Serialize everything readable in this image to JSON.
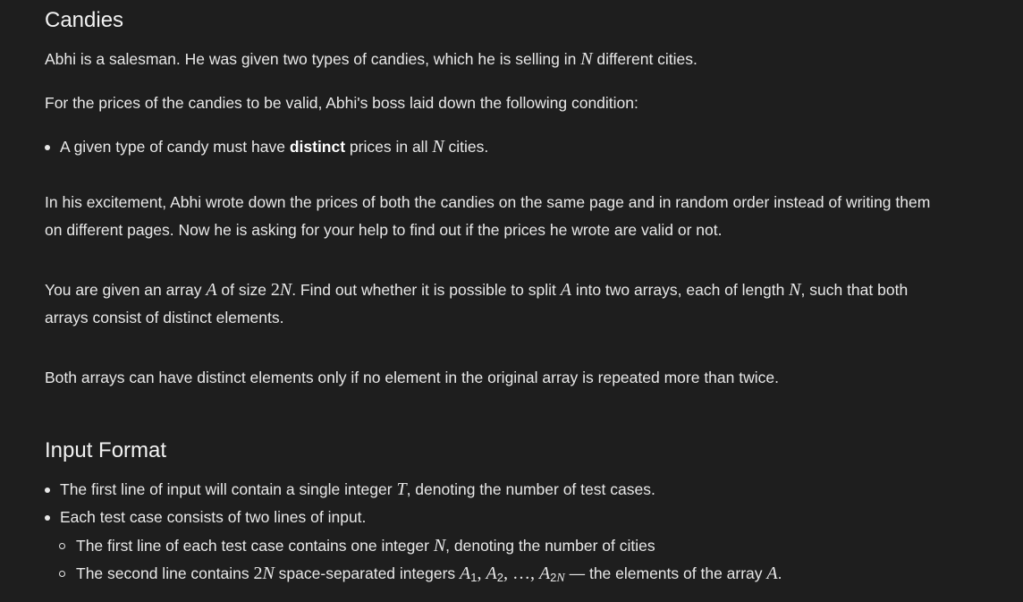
{
  "title": "Candies",
  "intro": {
    "p1_a": "Abhi is a salesman. He was given two types of candies, which he is selling in ",
    "p1_N": "N",
    "p1_b": " different cities.",
    "p2": "For the prices of the candies to be valid, Abhi's boss laid down the following condition:",
    "bullet_a": "A given type of candy must have ",
    "bullet_bold": "distinct",
    "bullet_b": " prices in all ",
    "bullet_N": "N",
    "bullet_c": " cities.",
    "p3_line1": "In his excitement, Abhi wrote down the prices of both the candies on the same page and in random order instead of writing them",
    "p3_line2": "on different pages. Now he is asking for your help to find out if the prices he wrote are valid or not.",
    "p4_a": "You are given an array ",
    "p4_A": "A",
    "p4_b": " of size ",
    "p4_2": "2",
    "p4_2N": "N",
    "p4_c": ". Find out whether it is possible to split ",
    "p4_A2": "A",
    "p4_d": " into two arrays, each of length ",
    "p4_N": "N",
    "p4_e": ", such that both",
    "p4_line2": "arrays consist of distinct elements.",
    "p5": "Both arrays can have distinct elements only if no element in the original array is repeated more than twice."
  },
  "input_format": {
    "heading": "Input Format",
    "item1_a": "The first line of input will contain a single integer ",
    "item1_T": "T",
    "item1_b": ", denoting the number of test cases.",
    "item2": "Each test case consists of two lines of input.",
    "sub1_a": "The first line of each test case contains one integer ",
    "sub1_N": "N",
    "sub1_b": ", denoting the number of cities",
    "sub2_a": "The second line contains ",
    "sub2_2": "2",
    "sub2_N": "N",
    "sub2_b": " space-separated integers ",
    "sub2_A1": "A",
    "sub2_s1": "1",
    "sub2_A2": "A",
    "sub2_s2": "2",
    "sub2_dots": ", …, ",
    "sub2_A3": "A",
    "sub2_s3a": "2",
    "sub2_s3b": "N",
    "sub2_c": " — the elements of the array ",
    "sub2_A": "A",
    "sub2_d": "."
  }
}
